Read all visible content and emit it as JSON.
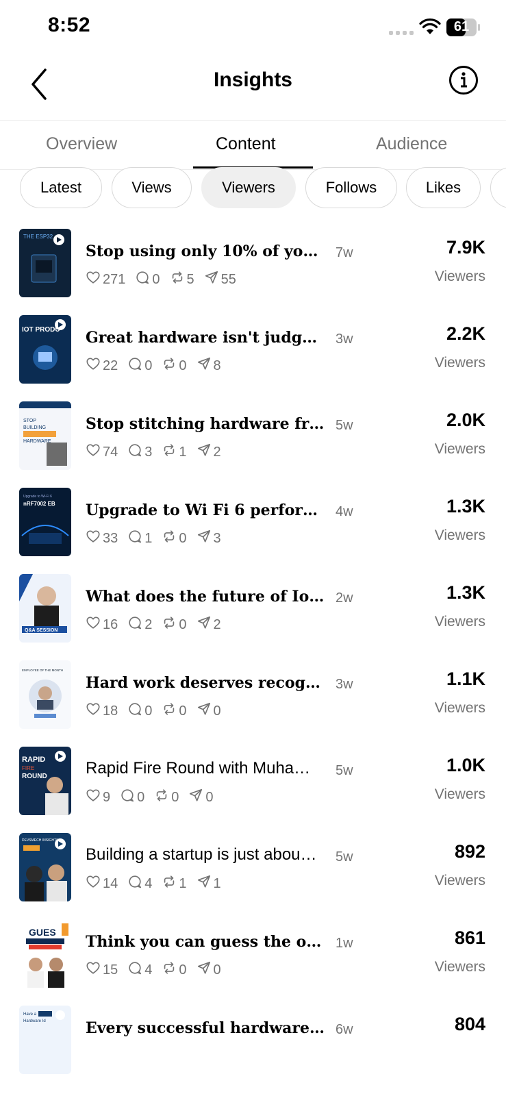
{
  "status_bar": {
    "time": "8:52",
    "battery": "61"
  },
  "header": {
    "title": "Insights"
  },
  "tabs": [
    {
      "label": "Overview",
      "active": false
    },
    {
      "label": "Content",
      "active": true
    },
    {
      "label": "Audience",
      "active": false
    }
  ],
  "chips": [
    {
      "label": "Latest",
      "selected": false
    },
    {
      "label": "Views",
      "selected": false
    },
    {
      "label": "Viewers",
      "selected": true
    },
    {
      "label": "Follows",
      "selected": false
    },
    {
      "label": "Likes",
      "selected": false
    }
  ],
  "posts": [
    {
      "title": "Stop using only 10% of your…",
      "age": "7w",
      "likes": "271",
      "comments": "0",
      "reposts": "5",
      "shares": "55",
      "value": "7.9K",
      "unit": "Viewers",
      "style": "serif",
      "thumb": "The ESP32 chip"
    },
    {
      "title": "Great hardware isn't judged…",
      "age": "3w",
      "likes": "22",
      "comments": "0",
      "reposts": "0",
      "shares": "8",
      "value": "2.2K",
      "unit": "Viewers",
      "style": "serif",
      "thumb": "IoT product"
    },
    {
      "title": "Stop stitching hardware fro…",
      "age": "5w",
      "likes": "74",
      "comments": "3",
      "reposts": "1",
      "shares": "2",
      "value": "2.0K",
      "unit": "Viewers",
      "style": "serif",
      "thumb": "Stop building Frankenstein hardware"
    },
    {
      "title": "Upgrade to Wi Fi 6 performa…",
      "age": "4w",
      "likes": "33",
      "comments": "1",
      "reposts": "0",
      "shares": "3",
      "value": "1.3K",
      "unit": "Viewers",
      "style": "serif",
      "thumb": "nRF7002 EB"
    },
    {
      "title": "What does the future of IoT r…",
      "age": "2w",
      "likes": "16",
      "comments": "2",
      "reposts": "0",
      "shares": "2",
      "value": "1.3K",
      "unit": "Viewers",
      "style": "serif",
      "thumb": "Q&A session"
    },
    {
      "title": "Hard work deserves recognit…",
      "age": "3w",
      "likes": "18",
      "comments": "0",
      "reposts": "0",
      "shares": "0",
      "value": "1.1K",
      "unit": "Viewers",
      "style": "serif",
      "thumb": "Employee of the month"
    },
    {
      "title": "Rapid Fire Round with Muha…",
      "age": "5w",
      "likes": "9",
      "comments": "0",
      "reposts": "0",
      "shares": "0",
      "value": "1.0K",
      "unit": "Viewers",
      "style": "sans",
      "thumb": "Rapid fire round"
    },
    {
      "title": "Building a startup is just abou…",
      "age": "5w",
      "likes": "14",
      "comments": "4",
      "reposts": "1",
      "shares": "1",
      "value": "892",
      "unit": "Viewers",
      "style": "sans",
      "thumb": "Podcast part"
    },
    {
      "title": "Think you can guess the obje…",
      "age": "1w",
      "likes": "15",
      "comments": "4",
      "reposts": "0",
      "shares": "0",
      "value": "861",
      "unit": "Viewers",
      "style": "serif",
      "thumb": "Guess the object challenge"
    },
    {
      "title": "Every successful hardware p…",
      "age": "6w",
      "likes": "",
      "comments": "",
      "reposts": "",
      "shares": "",
      "value": "804",
      "unit": "",
      "style": "serif",
      "thumb": "Have a million dollar hardware idea"
    }
  ]
}
